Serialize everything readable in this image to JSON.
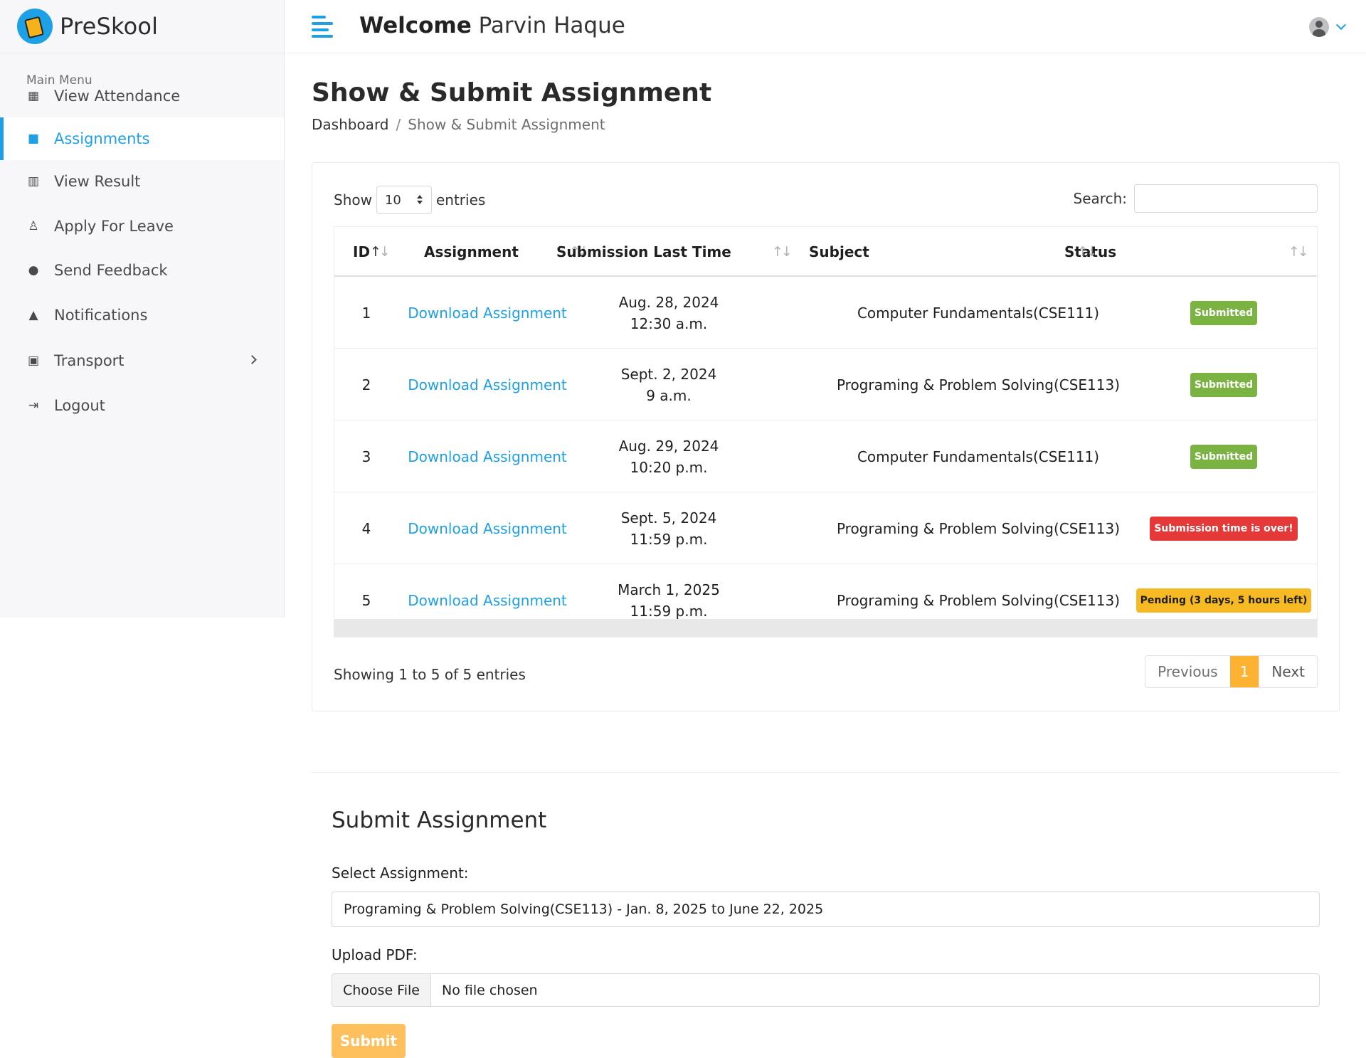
{
  "brand": {
    "name": "PreSkool"
  },
  "header": {
    "welcome_prefix": "Welcome",
    "user_name": "Parvin Haque"
  },
  "sidebar": {
    "title": "Main Menu",
    "items": [
      {
        "label": "View Attendance",
        "icon": "calendar-icon"
      },
      {
        "label": "Assignments",
        "icon": "file-icon",
        "active": true
      },
      {
        "label": "View Result",
        "icon": "chart-icon"
      },
      {
        "label": "Apply For Leave",
        "icon": "person-icon"
      },
      {
        "label": "Send Feedback",
        "icon": "comment-icon"
      },
      {
        "label": "Notifications",
        "icon": "bell-icon"
      },
      {
        "label": "Transport",
        "icon": "bus-icon",
        "has_submenu": true
      },
      {
        "label": "Logout",
        "icon": "logout-icon"
      }
    ]
  },
  "page": {
    "title": "Show & Submit Assignment",
    "breadcrumb": [
      "Dashboard",
      "Show & Submit Assignment"
    ]
  },
  "table_controls": {
    "show_label": "Show",
    "entries_value": "10",
    "entries_label": "entries",
    "search_label": "Search:",
    "search_value": ""
  },
  "table": {
    "columns": [
      "ID",
      "Assignment",
      "Submission Last Time",
      "Subject",
      "Status"
    ],
    "rows": [
      {
        "id": "1",
        "assignment": "Download Assignment",
        "date": "Aug. 28, 2024",
        "time": "12:30 a.m.",
        "subject": "Computer Fundamentals(CSE111)",
        "status": "Submitted",
        "status_color": "#7bb342"
      },
      {
        "id": "2",
        "assignment": "Download Assignment",
        "date": "Sept. 2, 2024",
        "time": "9 a.m.",
        "subject": "Programing & Problem Solving(CSE113)",
        "status": "Submitted",
        "status_color": "#7bb342"
      },
      {
        "id": "3",
        "assignment": "Download Assignment",
        "date": "Aug. 29, 2024",
        "time": "10:20 p.m.",
        "subject": "Computer Fundamentals(CSE111)",
        "status": "Submitted",
        "status_color": "#7bb342"
      },
      {
        "id": "4",
        "assignment": "Download Assignment",
        "date": "Sept. 5, 2024",
        "time": "11:59 p.m.",
        "subject": "Programing & Problem Solving(CSE113)",
        "status": "Submission time is over!",
        "status_color": "#e53939"
      },
      {
        "id": "5",
        "assignment": "Download Assignment",
        "date": "March 1, 2025",
        "time": "11:59 p.m.",
        "subject": "Programing & Problem Solving(CSE113)",
        "status": "Pending (3 days, 5 hours left)",
        "status_color": "#f7b924"
      }
    ]
  },
  "table_footer": {
    "info": "Showing 1 to 5 of 5 entries",
    "previous": "Previous",
    "current_page": "1",
    "next": "Next"
  },
  "form": {
    "title": "Submit Assignment",
    "select_label": "Select Assignment:",
    "select_value": "Programing & Problem Solving(CSE113) - Jan. 8, 2025 to June 22, 2025",
    "upload_label": "Upload PDF:",
    "file_button": "Choose File",
    "file_status": "No file chosen",
    "submit": "Submit"
  },
  "colors": {
    "accent": "#1ea0e6",
    "pagination_active": "#fdb232",
    "submit_button": "#fdc05c"
  }
}
